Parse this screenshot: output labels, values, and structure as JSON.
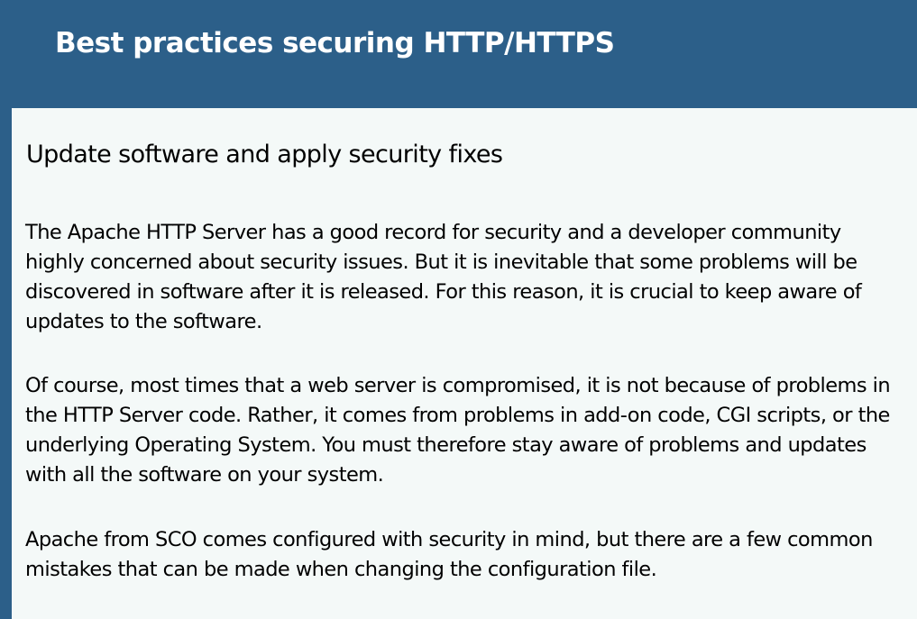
{
  "slide": {
    "title": "Best practices securing HTTP/HTTPS",
    "subheading": "Update software and apply security fixes",
    "paragraphs": [
      "The Apache HTTP Server has a good record for security and a developer community highly concerned about security issues. But it is inevitable that some problems will be discovered in software after it is released. For this reason, it is crucial to keep aware of updates to the software.",
      "Of course, most times that a web server is compromised, it is not because of problems in the HTTP Server code. Rather, it comes from problems in add-on code, CGI scripts, or the underlying Operating System. You must therefore stay aware of problems and updates with all the software on your system.",
      "Apache from SCO comes configured with security in mind, but there are a few common mistakes that can be made when changing the configuration file."
    ]
  },
  "colors": {
    "header_background": "#2c5f89",
    "content_background": "#f4f9f8",
    "title_text": "#ffffff",
    "body_text": "#000000"
  }
}
